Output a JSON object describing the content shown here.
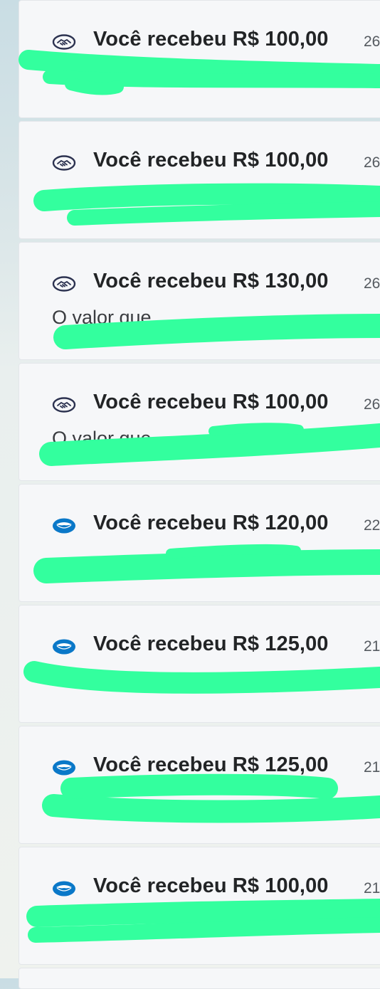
{
  "notifications": [
    {
      "icon": "handshake-icon",
      "title": "Você recebeu R$ 100,00",
      "date": "26",
      "description": ""
    },
    {
      "icon": "handshake-icon",
      "title": "Você recebeu R$ 100,00",
      "date": "26",
      "description": ""
    },
    {
      "icon": "handshake-icon",
      "title": "Você recebeu R$ 130,00",
      "date": "26",
      "description": "O valor que"
    },
    {
      "icon": "handshake-icon",
      "title": "Você recebeu R$ 100,00",
      "date": "26",
      "description": "O valor que"
    },
    {
      "icon": "mercadopago-icon",
      "title": "Você recebeu R$ 120,00",
      "date": "22",
      "description": ""
    },
    {
      "icon": "mercadopago-icon",
      "title": "Você recebeu R$ 125,00",
      "date": "21",
      "description": ""
    },
    {
      "icon": "mercadopago-icon",
      "title": "Você recebeu R$ 125,00",
      "date": "21",
      "description": ""
    },
    {
      "icon": "mercadopago-icon",
      "title": "Você recebeu R$ 100,00",
      "date": "21",
      "description": ""
    }
  ],
  "colors": {
    "card_background": "#f6f7f9",
    "handshake_icon": "#2c3250",
    "mercadopago_icon": "#0a78c8",
    "redaction": "#33ff9e"
  }
}
